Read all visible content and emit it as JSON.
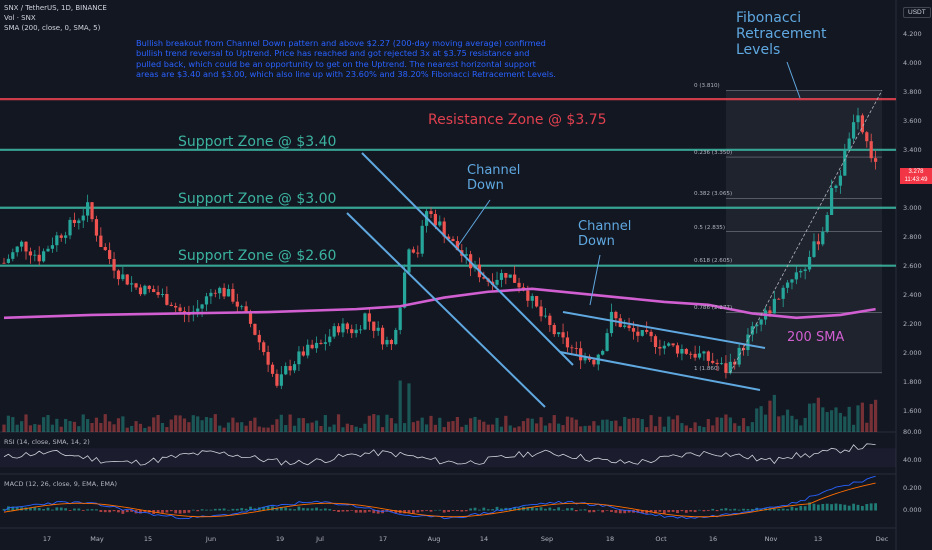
{
  "header": {
    "symbol_line": "SNX / TetherUS, 1D, BINANCE",
    "vol_line": "Vol · SNX",
    "sma_line": "SMA (200, close, 0, SMA, 5)"
  },
  "description": "Bullish breakout from Channel Down pattern and above $2.27 (200-day moving average) confirmed bullish trend reversal to Uptrend. Price has reached and got rejected 3x at $3.75 resistance and pulled back, which could be an opportunity to get on the Uptrend. The nearest horizontal support areas are $3.40 and $3.00, which also line up with 23.60% and 38.20% Fibonacci Retracement Levels.",
  "annotations": {
    "resistance": "Resistance Zone @ $3.75",
    "support_340": "Support Zone @ $3.40",
    "support_300": "Support Zone @ $3.00",
    "support_260": "Support Zone @ $2.60",
    "channel_down_1": "Channel\nDown",
    "channel_down_2": "Channel\nDown",
    "fib_title": "Fibonacci\nRetracement\nLevels",
    "sma_label": "200 SMA"
  },
  "currency_label": "USDT",
  "price_tag": {
    "value": "3.278",
    "sub": "11:43:49"
  },
  "rsi_label": "RSI (14, close, SMA, 14, 2)",
  "macd_label": "MACD (12, 26, close, 9, EMA, EMA)",
  "colors": {
    "background": "#131722",
    "up": "#26a69a",
    "down": "#ef5350",
    "support": "#3bb3a0",
    "resistance": "#e0404f",
    "channel": "#5fa8e0",
    "sma": "#d15fd1",
    "text_blue": "#2962ff"
  },
  "chart_data": [
    {
      "type": "candlestick",
      "axis": {
        "ylim": [
          1.5,
          4.4
        ],
        "yticks": [
          1.6,
          1.8,
          2.0,
          2.2,
          2.4,
          2.6,
          2.8,
          3.0,
          3.2,
          3.4,
          3.6,
          3.8,
          4.0,
          4.2
        ]
      },
      "xticks": [
        "17",
        "May",
        "15",
        "Jun",
        "19",
        "Jul",
        "17",
        "Aug",
        "14",
        "Sep",
        "18",
        "Oct",
        "16",
        "Nov",
        "13",
        "Dec"
      ],
      "close_path": [
        [
          0,
          2.62
        ],
        [
          4,
          2.75
        ],
        [
          8,
          2.66
        ],
        [
          12,
          2.8
        ],
        [
          16,
          2.9
        ],
        [
          19,
          3.0
        ],
        [
          22,
          2.75
        ],
        [
          26,
          2.55
        ],
        [
          30,
          2.45
        ],
        [
          34,
          2.42
        ],
        [
          38,
          2.35
        ],
        [
          41,
          2.25
        ],
        [
          44,
          2.3
        ],
        [
          48,
          2.45
        ],
        [
          52,
          2.38
        ],
        [
          56,
          2.2
        ],
        [
          60,
          1.95
        ],
        [
          62,
          1.75
        ],
        [
          64,
          1.88
        ],
        [
          68,
          2.0
        ],
        [
          72,
          2.05
        ],
        [
          76,
          2.18
        ],
        [
          80,
          2.15
        ],
        [
          82,
          2.26
        ],
        [
          86,
          2.1
        ],
        [
          88,
          2.05
        ],
        [
          90,
          2.35
        ],
        [
          92,
          2.75
        ],
        [
          94,
          2.7
        ],
        [
          96,
          2.98
        ],
        [
          99,
          2.88
        ],
        [
          102,
          2.75
        ],
        [
          106,
          2.6
        ],
        [
          110,
          2.5
        ],
        [
          114,
          2.55
        ],
        [
          118,
          2.45
        ],
        [
          122,
          2.25
        ],
        [
          126,
          2.1
        ],
        [
          130,
          2.0
        ],
        [
          134,
          1.95
        ],
        [
          136,
          2.05
        ],
        [
          138,
          2.25
        ],
        [
          142,
          2.15
        ],
        [
          146,
          2.1
        ],
        [
          150,
          2.05
        ],
        [
          154,
          2.02
        ],
        [
          158,
          1.98
        ],
        [
          162,
          1.92
        ],
        [
          164,
          1.88
        ],
        [
          167,
          2.0
        ],
        [
          170,
          2.15
        ],
        [
          174,
          2.3
        ],
        [
          178,
          2.5
        ],
        [
          182,
          2.6
        ],
        [
          186,
          2.85
        ],
        [
          188,
          3.1
        ],
        [
          190,
          3.25
        ],
        [
          192,
          3.5
        ],
        [
          194,
          3.6
        ],
        [
          196,
          3.45
        ],
        [
          198,
          3.278
        ]
      ],
      "series": [
        {
          "name": "200 SMA",
          "values": [
            [
              0,
              2.24
            ],
            [
              20,
              2.26
            ],
            [
              40,
              2.27
            ],
            [
              60,
              2.28
            ],
            [
              80,
              2.3
            ],
            [
              90,
              2.32
            ],
            [
              100,
              2.38
            ],
            [
              110,
              2.42
            ],
            [
              120,
              2.44
            ],
            [
              130,
              2.41
            ],
            [
              140,
              2.38
            ],
            [
              150,
              2.35
            ],
            [
              160,
              2.33
            ],
            [
              170,
              2.27
            ],
            [
              180,
              2.24
            ],
            [
              190,
              2.26
            ],
            [
              198,
              2.3
            ]
          ]
        }
      ],
      "levels": [
        {
          "name": "Resistance Zone @ $3.75",
          "value": 3.75
        },
        {
          "name": "Support Zone @ $3.40",
          "value": 3.4
        },
        {
          "name": "Support Zone @ $3.00",
          "value": 3.0
        },
        {
          "name": "Support Zone @ $2.60",
          "value": 2.6
        }
      ],
      "fibonacci": [
        {
          "label": "0 (3.810)",
          "value": 3.81
        },
        {
          "label": "0.236 (3.350)",
          "value": 3.35
        },
        {
          "label": "0.382 (3.065)",
          "value": 3.065
        },
        {
          "label": "0.5 (2.835)",
          "value": 2.835
        },
        {
          "label": "0.618 (2.605)",
          "value": 2.605
        },
        {
          "label": "0.786 (2.277)",
          "value": 2.277
        },
        {
          "label": "1 (1.860)",
          "value": 1.86
        }
      ]
    },
    {
      "type": "line",
      "name": "RSI",
      "yticks": [
        40.0,
        80.0
      ]
    },
    {
      "type": "line",
      "name": "MACD",
      "yticks": [
        0.2,
        0.0
      ]
    }
  ]
}
